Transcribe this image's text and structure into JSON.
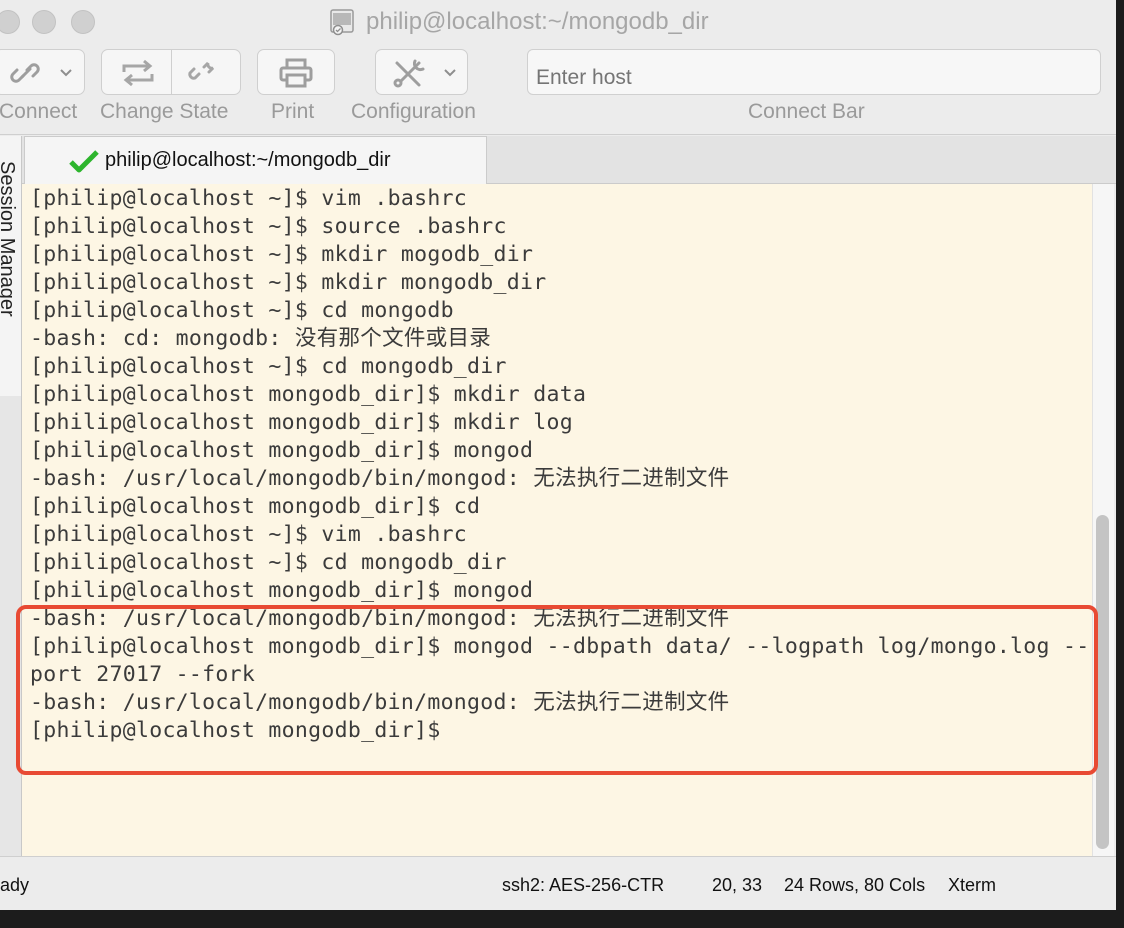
{
  "window": {
    "title": "philip@localhost:~/mongodb_dir"
  },
  "toolbar": {
    "connect_label": "Connect",
    "change_state_label": "Change State",
    "print_label": "Print",
    "configuration_label": "Configuration",
    "connect_bar_label": "Connect Bar",
    "host_placeholder": "Enter host"
  },
  "sidebar": {
    "label": "Session Manager"
  },
  "tab": {
    "title": "philip@localhost:~/mongodb_dir"
  },
  "terminal": {
    "lines": [
      "[philip@localhost ~]$ vim .bashrc",
      "[philip@localhost ~]$ source .bashrc",
      "[philip@localhost ~]$ mkdir mogodb_dir",
      "[philip@localhost ~]$ mkdir mongodb_dir",
      "[philip@localhost ~]$ cd mongodb",
      "-bash: cd: mongodb: 没有那个文件或目录",
      "[philip@localhost ~]$ cd mongodb_dir",
      "[philip@localhost mongodb_dir]$ mkdir data",
      "[philip@localhost mongodb_dir]$ mkdir log",
      "[philip@localhost mongodb_dir]$ mongod",
      "-bash: /usr/local/mongodb/bin/mongod: 无法执行二进制文件",
      "[philip@localhost mongodb_dir]$ cd",
      "[philip@localhost ~]$ vim .bashrc",
      "[philip@localhost ~]$ cd mongodb_dir",
      "[philip@localhost mongodb_dir]$ mongod",
      "-bash: /usr/local/mongodb/bin/mongod: 无法执行二进制文件",
      "[philip@localhost mongodb_dir]$ mongod --dbpath data/ --logpath log/mongo.log --",
      "port 27017 --fork",
      "-bash: /usr/local/mongodb/bin/mongod: 无法执行二进制文件",
      "[philip@localhost mongodb_dir]$"
    ]
  },
  "status": {
    "ready": "ady",
    "encryption": "ssh2: AES-256-CTR",
    "cursor": "20,  33",
    "size": "24 Rows, 80 Cols",
    "emulation": "Xterm"
  },
  "colors": {
    "terminal_bg": "#fdf6e4",
    "terminal_text": "#3b3b3b",
    "highlight_border": "#e84a33",
    "tab_check": "#2db52d"
  }
}
